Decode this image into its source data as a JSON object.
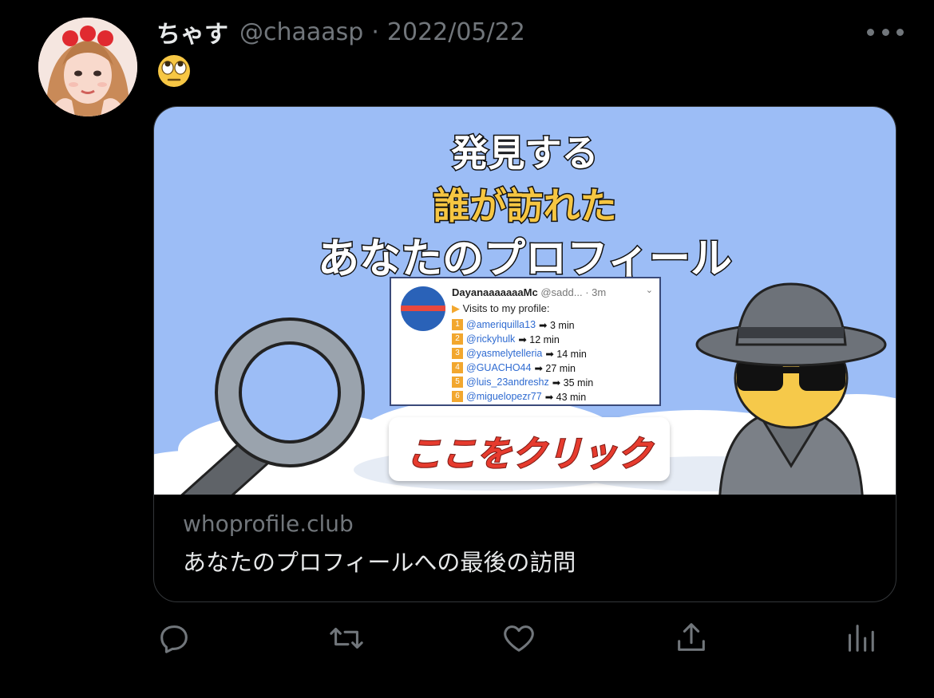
{
  "tweet": {
    "display_name": "ちゃす",
    "handle": "@chaaasp",
    "separator": "·",
    "date": "2022/05/22",
    "text_emoji": "🙄"
  },
  "icons": {
    "more": "more-horizontal-icon",
    "reply": "reply-icon",
    "retweet": "retweet-icon",
    "like": "heart-icon",
    "share": "share-icon",
    "analytics": "analytics-icon"
  },
  "card": {
    "image": {
      "headline_line1": "発見する",
      "headline_line2": "誰が訪れた",
      "headline_line3": "あなたのプロフィール",
      "cta": "ここをクリック",
      "screenshot": {
        "user": "DayanaaaaaaaMc",
        "at": "@sadd...",
        "time": "· 3m",
        "visits_label": "Visits to my profile:",
        "entries": [
          {
            "num": "1",
            "user": "@ameriquilla13",
            "time": "➡ 3 min"
          },
          {
            "num": "2",
            "user": "@rickyhulk",
            "time": "➡ 12 min"
          },
          {
            "num": "3",
            "user": "@yasmelytelleria",
            "time": "➡ 14 min"
          },
          {
            "num": "4",
            "user": "@GUACHO44",
            "time": "➡ 27 min"
          },
          {
            "num": "5",
            "user": "@luis_23andreshz",
            "time": "➡ 35 min"
          },
          {
            "num": "6",
            "user": "@miguelopezr77",
            "time": "➡ 43 min"
          }
        ]
      }
    },
    "domain": "whoprofile.club",
    "title": "あなたのプロフィールへの最後の訪問"
  },
  "colors": {
    "background": "#000000",
    "text_primary": "#e7e9ea",
    "text_secondary": "#71767b",
    "card_sky": "#9cbdf6",
    "headline_yellow": "#f6c642",
    "cta_red": "#e63b2e"
  }
}
